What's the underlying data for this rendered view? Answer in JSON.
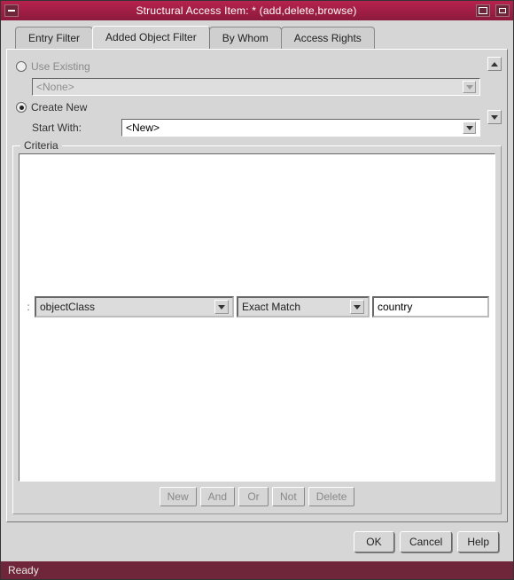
{
  "window": {
    "title": "Structural Access Item:   * (add,delete,browse)",
    "status": "Ready"
  },
  "tabs": [
    {
      "label": "Entry Filter"
    },
    {
      "label": "Added Object Filter"
    },
    {
      "label": "By Whom"
    },
    {
      "label": "Access Rights"
    }
  ],
  "active_tab_index": 1,
  "options": {
    "use_existing": {
      "label": "Use Existing",
      "checked": false,
      "dropdown_value": "<None>"
    },
    "create_new": {
      "label": "Create New",
      "checked": true
    },
    "start_with": {
      "label": "Start With:",
      "value": "<New>"
    }
  },
  "criteria": {
    "legend": "Criteria",
    "row": {
      "attribute": "objectClass",
      "match": "Exact Match",
      "value": "country"
    },
    "buttons": {
      "new": "New",
      "and": "And",
      "or": "Or",
      "not": "Not",
      "delete": "Delete"
    }
  },
  "dialog_buttons": {
    "ok": "OK",
    "cancel": "Cancel",
    "help": "Help"
  }
}
